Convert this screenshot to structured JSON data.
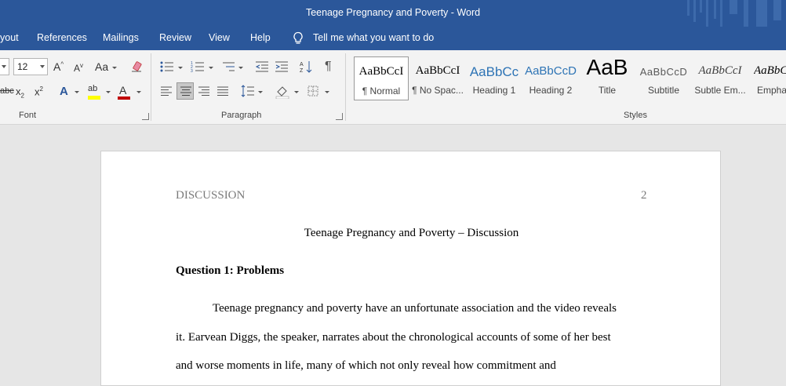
{
  "window": {
    "title": "Teenage Pregnancy and Poverty  -  Word"
  },
  "tabs": [
    "yout",
    "References",
    "Mailings",
    "Review",
    "View",
    "Help"
  ],
  "tell_me": {
    "placeholder": "Tell me what you want to do"
  },
  "font_group": {
    "label": "Font",
    "size_value": "12",
    "grow_font": "A",
    "shrink_font": "A",
    "change_case": "Aa",
    "subscript": "x",
    "superscript": "x",
    "strikethrough": "abc",
    "font_color": "A",
    "highlight": "ab"
  },
  "paragraph_group": {
    "label": "Paragraph"
  },
  "styles_group": {
    "label": "Styles",
    "items": [
      {
        "preview": "AaBbCcI",
        "name": "¶ Normal"
      },
      {
        "preview": "AaBbCcI",
        "name": "¶ No Spac..."
      },
      {
        "preview": "AaBbCc",
        "name": "Heading 1"
      },
      {
        "preview": "AaBbCcD",
        "name": "Heading 2"
      },
      {
        "preview": "AaB",
        "name": "Title"
      },
      {
        "preview": "AaBbCcD",
        "name": "Subtitle"
      },
      {
        "preview": "AaBbCcI",
        "name": "Subtle Em..."
      },
      {
        "preview": "AaBbCc",
        "name": "Empha"
      }
    ]
  },
  "document": {
    "running_head": "DISCUSSION",
    "page_number": "2",
    "title": "Teenage Pregnancy and Poverty – Discussion",
    "heading": "Question 1: Problems",
    "lines": [
      "Teenage pregnancy and poverty have an unfortunate association and the video reveals",
      "it. Earvean Diggs, the speaker, narrates about the chronological accounts of some of her best",
      "and worse moments in life, many of which not only reveal how commitment and"
    ]
  },
  "colors": {
    "titlebar": "#2b579a",
    "ribbon": "#f3f3f3",
    "canvas": "#e6e6e6",
    "font_color_red": "#c00000",
    "highlight_yellow": "#ffff00"
  }
}
